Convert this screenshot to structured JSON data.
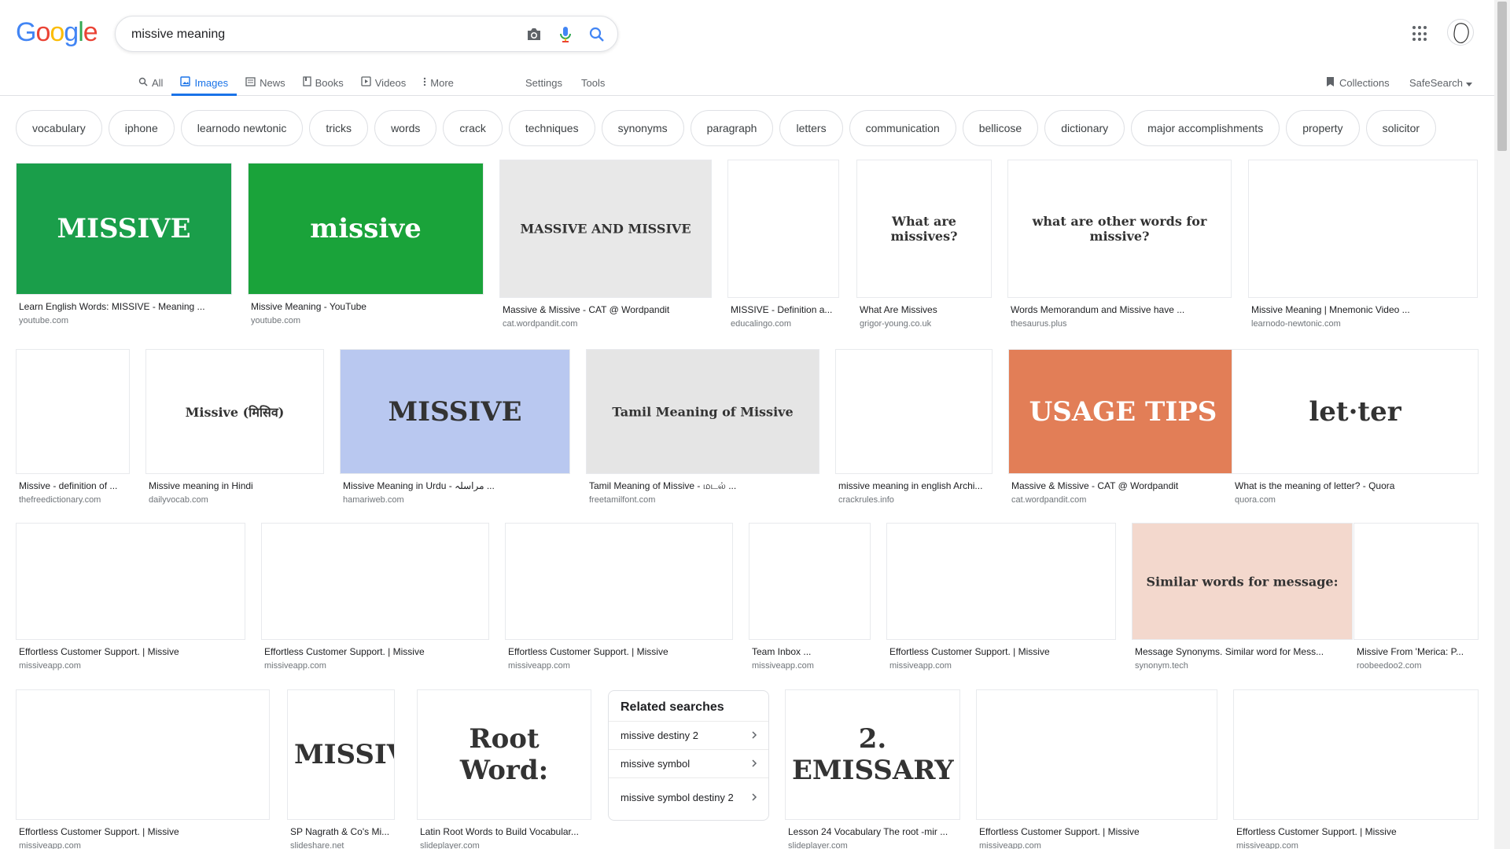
{
  "header": {
    "logo": "Google",
    "logo_colors": [
      "#4285F4",
      "#EA4335",
      "#FBBC05",
      "#4285F4",
      "#34A853",
      "#EA4335"
    ],
    "query": "missive meaning",
    "icons": [
      "camera-icon",
      "mic-icon",
      "search-icon",
      "apps-icon",
      "avatar"
    ]
  },
  "tabs": [
    {
      "label": "All",
      "icon": "search-icon"
    },
    {
      "label": "Images",
      "icon": "image-icon",
      "active": true
    },
    {
      "label": "News",
      "icon": "news-icon"
    },
    {
      "label": "Books",
      "icon": "book-icon"
    },
    {
      "label": "Videos",
      "icon": "video-icon"
    },
    {
      "label": "More",
      "icon": "more-icon"
    }
  ],
  "settings_label": "Settings",
  "tools_label": "Tools",
  "collections_label": "Collections",
  "safesearch_label": "SafeSearch",
  "chips": [
    "vocabulary",
    "iphone",
    "learnodo newtonic",
    "tricks",
    "words",
    "crack",
    "techniques",
    "synonyms",
    "paragraph",
    "letters",
    "communication",
    "bellicose",
    "dictionary",
    "major accomplishments",
    "property",
    "solicitor"
  ],
  "results": [
    {
      "caption": "Learn English Words: MISSIVE - Meaning ...",
      "source": "youtube.com",
      "thumb_text": "MISSIVE",
      "bg": "#1a9e4a"
    },
    {
      "caption": "Missive Meaning - YouTube",
      "source": "youtube.com",
      "thumb_text": "missive",
      "bg": "#1aa33a"
    },
    {
      "caption": "Massive & Missive - CAT @ Wordpandit",
      "source": "cat.wordpandit.com",
      "thumb_text": "MASSIVE AND MISSIVE",
      "bg": "#e8e8e8"
    },
    {
      "caption": "MISSIVE - Definition a...",
      "source": "educalingo.com",
      "thumb_text": "",
      "bg": "#ffffff"
    },
    {
      "caption": "What Are Missives",
      "source": "grigor-young.co.uk",
      "thumb_text": "What are missives?",
      "bg": "#ffffff"
    },
    {
      "caption": "Words Memorandum and Missive have ...",
      "source": "thesaurus.plus",
      "thumb_text": "what are other words for missive?",
      "bg": "#ffffff"
    },
    {
      "caption": "Missive Meaning | Mnemonic Video ...",
      "source": "learnodo-newtonic.com",
      "thumb_text": "",
      "bg": "#ffffff"
    },
    {
      "caption": "Missive - definition of ...",
      "source": "thefreedictionary.com",
      "thumb_text": "",
      "bg": "#ffffff"
    },
    {
      "caption": "Missive meaning in Hindi",
      "source": "dailyvocab.com",
      "thumb_text": "Missive (मिसिव)",
      "bg": "#ffffff"
    },
    {
      "caption": "Missive Meaning in Urdu - مراسلہ ...",
      "source": "hamariweb.com",
      "thumb_text": "MISSIVE",
      "bg": "#b9c8f0"
    },
    {
      "caption": "Tamil Meaning of Missive - மடல் ...",
      "source": "freetamilfont.com",
      "thumb_text": "Tamil Meaning of Missive",
      "bg": "#e5e5e5"
    },
    {
      "caption": "missive meaning in english Archi...",
      "source": "crackrules.info",
      "thumb_text": "",
      "bg": "#ffffff"
    },
    {
      "caption": "Massive & Missive - CAT @ Wordpandit",
      "source": "cat.wordpandit.com",
      "thumb_text": "USAGE TIPS",
      "bg": "#e27e57"
    },
    {
      "caption": "What is the meaning of letter? - Quora",
      "source": "quora.com",
      "thumb_text": "let·ter",
      "bg": "#ffffff"
    },
    {
      "caption": "Effortless Customer Support. | Missive",
      "source": "missiveapp.com",
      "thumb_text": "",
      "bg": "#ffffff"
    },
    {
      "caption": "Effortless Customer Support. | Missive",
      "source": "missiveapp.com",
      "thumb_text": "",
      "bg": "#ffffff"
    },
    {
      "caption": "Effortless Customer Support. | Missive",
      "source": "missiveapp.com",
      "thumb_text": "",
      "bg": "#ffffff"
    },
    {
      "caption": "Team Inbox ...",
      "source": "missiveapp.com",
      "thumb_text": "",
      "bg": "#ffffff"
    },
    {
      "caption": "Effortless Customer Support. | Missive",
      "source": "missiveapp.com",
      "thumb_text": "",
      "bg": "#ffffff"
    },
    {
      "caption": "Message Synonyms. Similar word for Mess...",
      "source": "synonym.tech",
      "thumb_text": "Similar words for message:",
      "bg": "#f3d8cd"
    },
    {
      "caption": "Missive From 'Merica: P...",
      "source": "roobeedoo2.com",
      "thumb_text": "",
      "bg": "#ffffff"
    },
    {
      "caption": "Effortless Customer Support. | Missive",
      "source": "missiveapp.com",
      "thumb_text": "",
      "bg": "#ffffff"
    },
    {
      "caption": "SP Nagrath & Co's Mi...",
      "source": "slideshare.net",
      "thumb_text": "MISSIVE",
      "bg": "#ffffff"
    },
    {
      "caption": "Latin Root Words to Build Vocabular...",
      "source": "slideplayer.com",
      "thumb_text": "Root Word:",
      "bg": "#ffffff"
    },
    {
      "caption": "Lesson 24 Vocabulary The root -mir ...",
      "source": "slideplayer.com",
      "thumb_text": "2. EMISSARY",
      "bg": "#ffffff"
    },
    {
      "caption": "Effortless Customer Support. | Missive",
      "source": "missiveapp.com",
      "thumb_text": "",
      "bg": "#ffffff"
    },
    {
      "caption": "Effortless Customer Support. | Missive",
      "source": "missiveapp.com",
      "thumb_text": "",
      "bg": "#ffffff"
    }
  ],
  "related": {
    "title": "Related searches",
    "items": [
      "missive destiny 2",
      "missive symbol",
      "missive symbol destiny 2"
    ]
  }
}
